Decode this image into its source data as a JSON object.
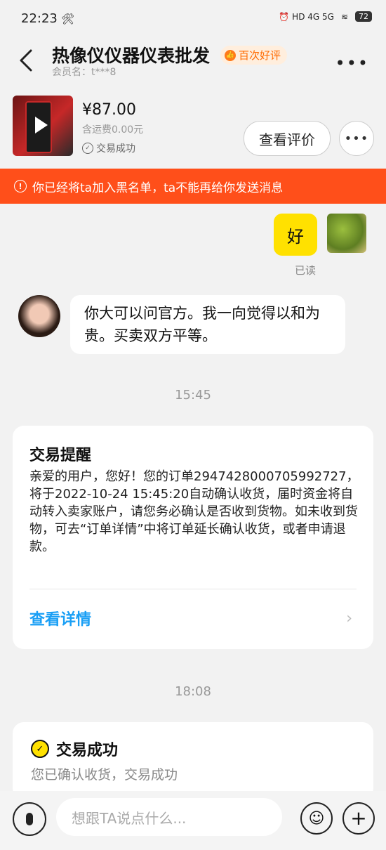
{
  "status_bar": {
    "time": "22:23",
    "tool_icon": "wrench-icon",
    "indicators": "⏰ HD 4G 5G",
    "battery": "72"
  },
  "header": {
    "title": "热像仪仪器仪表批发",
    "badge": "百次好评",
    "member": "会员名：t***8"
  },
  "product": {
    "price": "¥87.00",
    "shipping": "含运费0.00元",
    "status": "交易成功",
    "review_button": "查看评价"
  },
  "alert": {
    "text": "你已经将ta加入黑名单，ta不能再给你发送消息",
    "color": "#ff4f1a"
  },
  "messages": {
    "mine_text": "好",
    "read_label": "已读",
    "other_text": "你大可以问官方。我一向觉得以和为贵。买卖双方平等。"
  },
  "timestamps": {
    "first": "15:45",
    "second": "18:08"
  },
  "trade_reminder": {
    "title": "交易提醒",
    "body": "亲爱的用户，您好！您的订单2947428000705992727，将于2022-10-24 15:45:20自动确认收货，届时资金将自动转入卖家账户，请您务必确认是否收到货物。如未收到货物，可去“订单详情”中将订单延长确认收货，或者申请退款。",
    "link": "查看详情",
    "link_color": "#1a9ff5"
  },
  "trade_success": {
    "title": "交易成功",
    "body": "您已确认收货，交易成功"
  },
  "input_bar": {
    "placeholder": "想跟TA说点什么..."
  }
}
